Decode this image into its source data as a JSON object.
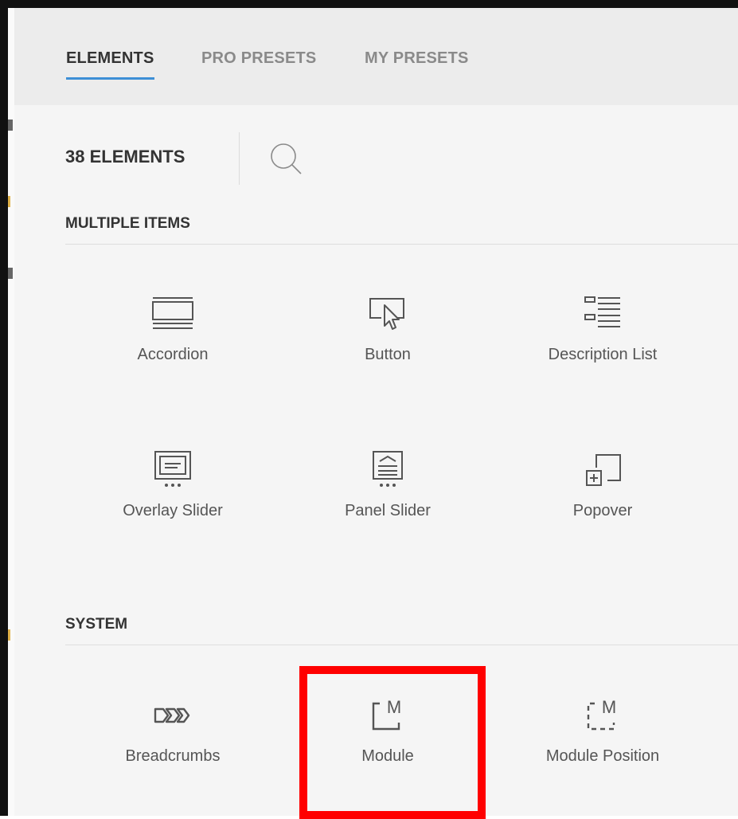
{
  "tabs": [
    {
      "label": "ELEMENTS",
      "active": true
    },
    {
      "label": "PRO PRESETS",
      "active": false
    },
    {
      "label": "MY PRESETS",
      "active": false
    }
  ],
  "element_count": "38 ELEMENTS",
  "icons": {
    "search": "search-icon"
  },
  "sections": [
    {
      "title": "MULTIPLE ITEMS",
      "items": [
        {
          "label": "Accordion",
          "icon": "accordion-icon"
        },
        {
          "label": "Button",
          "icon": "button-icon"
        },
        {
          "label": "Description List",
          "icon": "description-list-icon"
        },
        {
          "label": "Overlay Slider",
          "icon": "overlay-slider-icon"
        },
        {
          "label": "Panel Slider",
          "icon": "panel-slider-icon"
        },
        {
          "label": "Popover",
          "icon": "popover-icon"
        }
      ]
    },
    {
      "title": "SYSTEM",
      "items": [
        {
          "label": "Breadcrumbs",
          "icon": "breadcrumbs-icon"
        },
        {
          "label": "Module",
          "icon": "module-icon"
        },
        {
          "label": "Module Position",
          "icon": "module-position-icon"
        }
      ]
    }
  ],
  "colors": {
    "accent": "#3d8fd6",
    "highlight": "#ff0000",
    "panel_bg": "#f5f5f5",
    "tabbar_bg": "#ececec"
  }
}
